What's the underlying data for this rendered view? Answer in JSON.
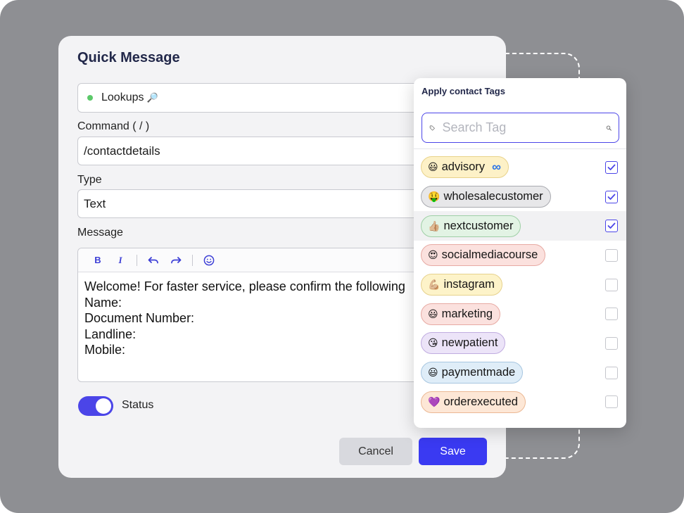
{
  "card": {
    "title": "Quick Message",
    "lookup": {
      "label": "Lookups",
      "icon": "🔎"
    },
    "command": {
      "label": "Command ( / )",
      "value": "/contactdetails"
    },
    "type": {
      "label": "Type",
      "value": "Text"
    },
    "message": {
      "label": "Message",
      "toolbar": [
        "bold-icon",
        "italic-icon",
        "undo-icon",
        "redo-icon",
        "emoji-icon"
      ],
      "body": "Welcome! For faster service, please confirm the following\nName:\nDocument Number:\nLandline:\nMobile:"
    },
    "status": {
      "label": "Status",
      "enabled": true
    },
    "cancel_label": "Cancel",
    "save_label": "Save"
  },
  "tag_popover": {
    "title": "Apply contact Tags",
    "search_placeholder": "Search Tag",
    "tags": [
      {
        "emoji": "😃",
        "label": "advisory",
        "extra": "∞",
        "checked": true,
        "bg": "#fdf1c7",
        "border": "#e8d28a"
      },
      {
        "emoji": "🤑",
        "label": "wholesalecustomer",
        "checked": true,
        "bg": "#e7e7e9",
        "border": "#a9aab0"
      },
      {
        "emoji": "👍🏼",
        "label": "nextcustomer",
        "checked": true,
        "bg": "#e2f3e4",
        "border": "#9fcfa6"
      },
      {
        "emoji": "😍",
        "label": "socialmediacourse",
        "checked": false,
        "bg": "#fbe1de",
        "border": "#e7aaa3"
      },
      {
        "emoji": "💪🏼",
        "label": "instagram",
        "checked": false,
        "bg": "#fdf3c9",
        "border": "#e6d18c"
      },
      {
        "emoji": "😃",
        "label": "marketing",
        "checked": false,
        "bg": "#fbe1de",
        "border": "#e7aaa3"
      },
      {
        "emoji": "😘",
        "label": "newpatient",
        "checked": false,
        "bg": "#ece4f8",
        "border": "#c0ace0"
      },
      {
        "emoji": "😃",
        "label": "paymentmade",
        "checked": false,
        "bg": "#dfedf8",
        "border": "#a7c6e0"
      },
      {
        "emoji": "💜",
        "label": "orderexecuted",
        "checked": false,
        "bg": "#fde7d6",
        "border": "#ebb894"
      }
    ]
  },
  "colors": {
    "accent": "#4b45e8",
    "save_button": "#3a3af2",
    "status_dot": "#5cc96a",
    "backdrop": "#8e8f93"
  }
}
